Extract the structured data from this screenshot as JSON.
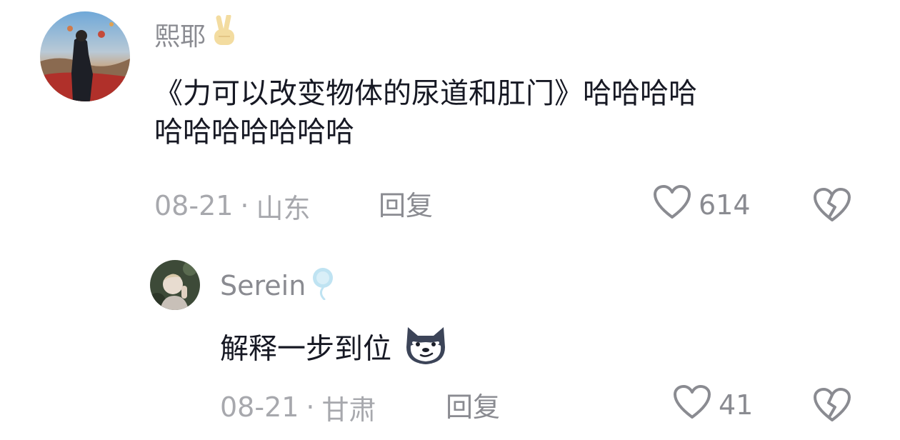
{
  "comments": [
    {
      "username": "熙耶",
      "username_badge_icon": "victory-hand-icon",
      "text_line1": "《力可以改变物体的尿道和肛门》哈哈哈哈",
      "text_line2": "哈哈哈哈哈哈哈",
      "date": "08-21",
      "separator": "·",
      "location": "山东",
      "reply_label": "回复",
      "likes": "614"
    },
    {
      "username": "Serein",
      "username_badge_icon": "balloon-icon",
      "text": "解释一步到位",
      "text_emoji_icon": "smug-dog-emoji",
      "date": "08-21",
      "separator": "·",
      "location": "甘肃",
      "reply_label": "回复",
      "likes": "41"
    }
  ],
  "colors": {
    "username": "#8a8b91",
    "text": "#161823",
    "meta": "#a7a8ad",
    "icon": "#8a8b91"
  }
}
